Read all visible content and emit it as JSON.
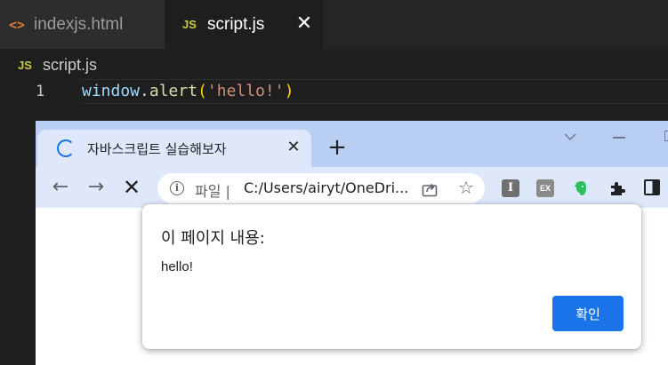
{
  "editor": {
    "tabs": [
      {
        "label": "indexjs.html",
        "icon": "html-file-icon",
        "icon_text": "<>",
        "active": false
      },
      {
        "label": "script.js",
        "icon": "js-file-icon",
        "icon_text": "JS",
        "active": true
      }
    ],
    "close_glyph": "✕",
    "breadcrumb": {
      "icon_text": "JS",
      "label": "script.js"
    },
    "code": {
      "line_number": "1",
      "tokens": {
        "object": "window",
        "dot": ".",
        "method": "alert",
        "open_paren": "(",
        "string": "'hello!'",
        "close_paren": ")"
      }
    }
  },
  "browser": {
    "tab": {
      "title": "자바스크립트 실습해보자",
      "close_glyph": "✕"
    },
    "new_tab_glyph": "+",
    "toolbar": {
      "back_glyph": "←",
      "forward_glyph": "→",
      "stop_glyph": "✕"
    },
    "omnibox": {
      "scheme_label": "파일 |",
      "url": "C:/Users/airyt/OneDri..."
    },
    "star_glyph": "☆",
    "extensions": {
      "i_label": "I",
      "ex_label": "EX"
    }
  },
  "dialog": {
    "title": "이 페이지 내용:",
    "message": "hello!",
    "ok_label": "확인"
  },
  "colors": {
    "editor_bg": "#1e1e1e",
    "chrome_frame": "#b8cef2",
    "chrome_toolbar": "#dee8fa",
    "accent_blue": "#1a73e8"
  }
}
